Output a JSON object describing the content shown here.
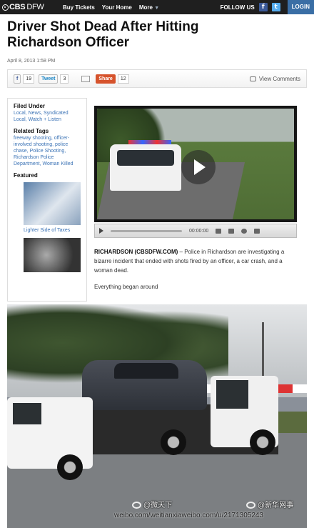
{
  "site": {
    "logo_brand": "CBS",
    "logo_city": "DFW"
  },
  "nav": {
    "items": [
      "Buy Tickets",
      "Your Home",
      "More"
    ],
    "more_caret": "▼",
    "follow_label": "FOLLOW US",
    "facebook_glyph": "f",
    "twitter_glyph": "t",
    "login_label": "LOGIN"
  },
  "article": {
    "headline": "Driver Shot Dead After Hitting Richardson Officer",
    "date": "April 8, 2013 1:58 PM",
    "dateline": "RICHARDSON (CBSDFW.COM)",
    "lead": " – Police in Richardson are investigating a bizarre incident that ended with shots fired by an officer, a car crash, and a woman dead.",
    "para2": "Everything began around"
  },
  "sharebar": {
    "fb_label": "f",
    "fb_count": "19",
    "tweet_label": "Tweet",
    "tweet_count": "3",
    "share_label": "Share",
    "share_count": "12",
    "view_comments": "View Comments"
  },
  "sidebar": {
    "filed_under_title": "Filed Under",
    "filed_under_links": "Local, News, Syndicated Local, Watch + Listen",
    "tags_title": "Related Tags",
    "tags_links": "freeway shooting, officer-involved shooting, police chase, Police Shooting, Richardson Police Department, Woman Killed",
    "featured_title": "Featured",
    "featured_caption": "Lighter Side of Taxes"
  },
  "video": {
    "time": "00:00:00"
  },
  "watermarks": {
    "weibo1": "@微天下",
    "weibo2": "@新华网事",
    "url": "weibo.com/weitianxiaweibo.com/u/2171305243"
  },
  "colors": {
    "topbar": "#1f1f1f",
    "login": "#3a6ea5",
    "link": "#3a72b5",
    "share": "#d6532c"
  }
}
